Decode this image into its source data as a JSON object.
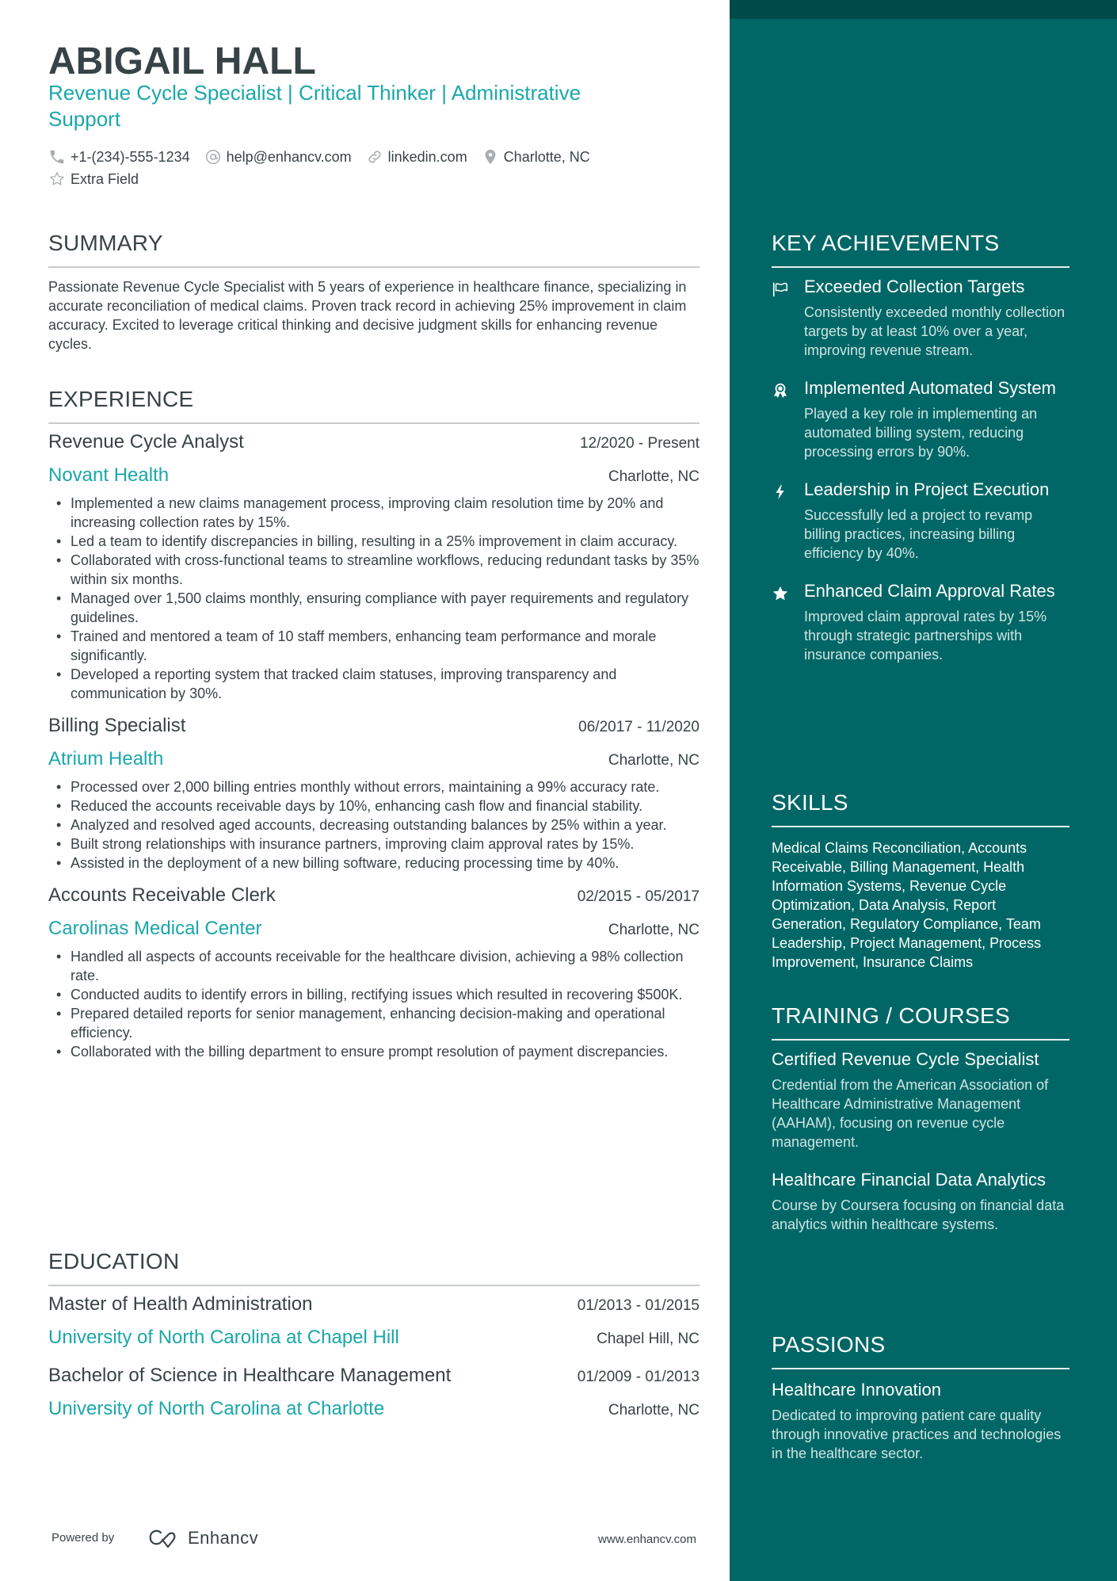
{
  "header": {
    "name": "ABIGAIL HALL",
    "headline_parts": [
      "Revenue Cycle Specialist",
      "Critical Thinker",
      "Administrative Support"
    ],
    "headline_separator": "|",
    "contacts": [
      {
        "icon": "phone-icon",
        "text": "+1-(234)-555-1234"
      },
      {
        "icon": "at-icon",
        "text": "help@enhancv.com"
      },
      {
        "icon": "link-icon",
        "text": "linkedin.com"
      },
      {
        "icon": "location-pin-icon",
        "text": "Charlotte, NC"
      },
      {
        "icon": "star-outline-icon",
        "text": "Extra Field"
      }
    ]
  },
  "summary": {
    "title": "SUMMARY",
    "text": "Passionate Revenue Cycle Specialist with 5 years of experience in healthcare finance, specializing in accurate reconciliation of medical claims. Proven track record in achieving 25% improvement in claim accuracy. Excited to leverage critical thinking and decisive judgment skills for enhancing revenue cycles."
  },
  "experience": {
    "title": "EXPERIENCE",
    "items": [
      {
        "role": "Revenue Cycle Analyst",
        "dates": "12/2020 - Present",
        "company": "Novant Health",
        "location": "Charlotte, NC",
        "bullets": [
          "Implemented a new claims management process, improving claim resolution time by 20% and increasing collection rates by 15%.",
          "Led a team to identify discrepancies in billing, resulting in a 25% improvement in claim accuracy.",
          "Collaborated with cross-functional teams to streamline workflows, reducing redundant tasks by 35% within six months.",
          "Managed over 1,500 claims monthly, ensuring compliance with payer requirements and regulatory guidelines.",
          "Trained and mentored a team of 10 staff members, enhancing team performance and morale significantly.",
          "Developed a reporting system that tracked claim statuses, improving transparency and communication by 30%."
        ]
      },
      {
        "role": "Billing Specialist",
        "dates": "06/2017 - 11/2020",
        "company": "Atrium Health",
        "location": "Charlotte, NC",
        "bullets": [
          "Processed over 2,000 billing entries monthly without errors, maintaining a 99% accuracy rate.",
          "Reduced the accounts receivable days by 10%, enhancing cash flow and financial stability.",
          "Analyzed and resolved aged accounts, decreasing outstanding balances by 25% within a year.",
          "Built strong relationships with insurance partners, improving claim approval rates by 15%.",
          "Assisted in the deployment of a new billing software, reducing processing time by 40%."
        ]
      },
      {
        "role": "Accounts Receivable Clerk",
        "dates": "02/2015 - 05/2017",
        "company": "Carolinas Medical Center",
        "location": "Charlotte, NC",
        "bullets": [
          "Handled all aspects of accounts receivable for the healthcare division, achieving a 98% collection rate.",
          "Conducted audits to identify errors in billing, rectifying issues which resulted in recovering $500K.",
          "Prepared detailed reports for senior management, enhancing decision-making and operational efficiency.",
          "Collaborated with the billing department to ensure prompt resolution of payment discrepancies."
        ]
      }
    ]
  },
  "education": {
    "title": "EDUCATION",
    "items": [
      {
        "degree": "Master of Health Administration",
        "dates": "01/2013 - 01/2015",
        "school": "University of North Carolina at Chapel Hill",
        "location": "Chapel Hill, NC"
      },
      {
        "degree": "Bachelor of Science in Healthcare Management",
        "dates": "01/2009 - 01/2013",
        "school": "University of North Carolina at Charlotte",
        "location": "Charlotte, NC"
      }
    ]
  },
  "footer": {
    "powered_by": "Powered by",
    "brand": "Enhancv",
    "website": "www.enhancv.com"
  },
  "achievements": {
    "title": "KEY ACHIEVEMENTS",
    "items": [
      {
        "icon": "flag-icon",
        "title": "Exceeded Collection Targets",
        "description": "Consistently exceeded monthly collection targets by at least 10% over a year, improving revenue stream."
      },
      {
        "icon": "award-medal-icon",
        "title": "Implemented Automated System",
        "description": "Played a key role in implementing an automated billing system, reducing processing errors by 90%."
      },
      {
        "icon": "lightning-bolt-icon",
        "title": "Leadership in Project Execution",
        "description": "Successfully led a project to revamp billing practices, increasing billing efficiency by 40%."
      },
      {
        "icon": "star-icon",
        "title": "Enhanced Claim Approval Rates",
        "description": "Improved claim approval rates by 15% through strategic partnerships with insurance companies."
      }
    ]
  },
  "skills": {
    "title": "SKILLS",
    "text": "Medical Claims Reconciliation, Accounts Receivable, Billing Management, Health Information Systems, Revenue Cycle Optimization, Data Analysis, Report Generation, Regulatory Compliance, Team Leadership, Project Management, Process Improvement, Insurance Claims"
  },
  "training": {
    "title": "TRAINING / COURSES",
    "items": [
      {
        "title": "Certified Revenue Cycle Specialist",
        "description": "Credential from the American Association of Healthcare Administrative Management (AAHAM), focusing on revenue cycle management."
      },
      {
        "title": "Healthcare Financial Data Analytics",
        "description": "Course by Coursera focusing on financial data analytics within healthcare systems."
      }
    ]
  },
  "passions": {
    "title": "PASSIONS",
    "items": [
      {
        "title": "Healthcare Innovation",
        "description": "Dedicated to improving patient care quality through innovative practices and technologies in the healthcare sector."
      }
    ]
  },
  "colors": {
    "accent": "#1aa7aa",
    "sidebar": "#006766",
    "sidebar_top": "#004a4a",
    "text": "#384347"
  }
}
